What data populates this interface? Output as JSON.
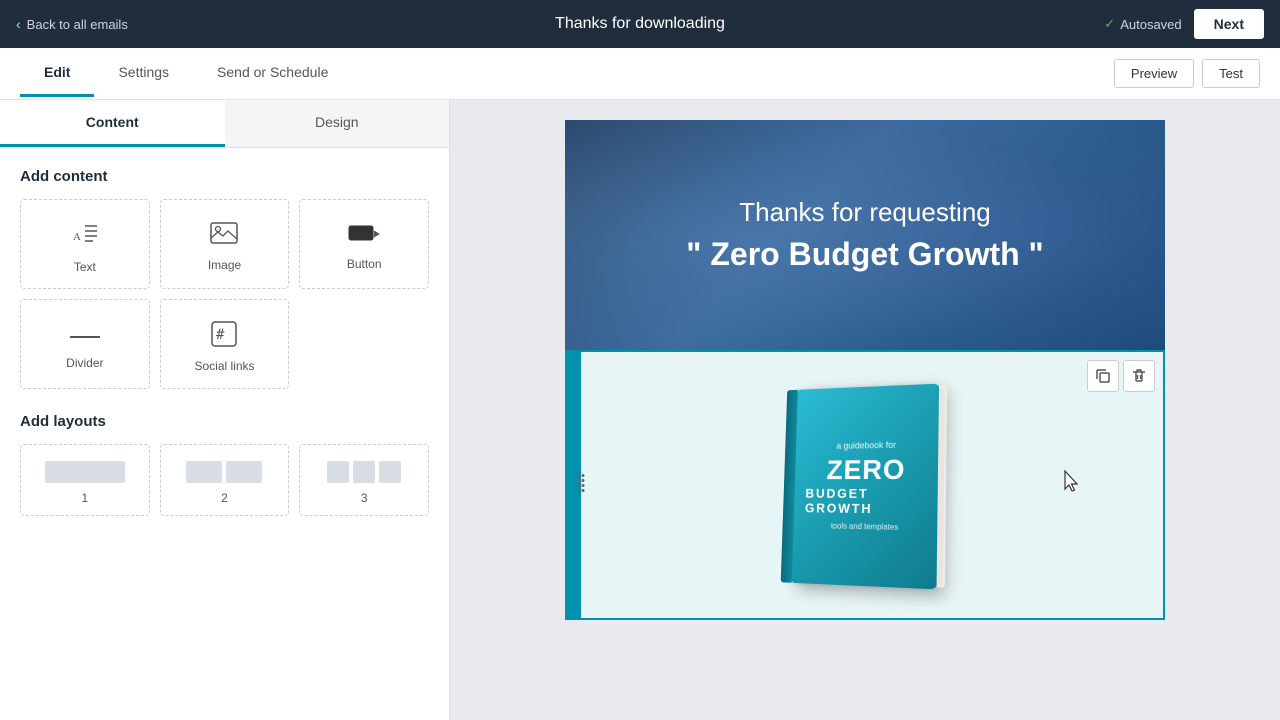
{
  "topNav": {
    "backLabel": "Back to all emails",
    "title": "Thanks for downloading",
    "autosaved": "Autosaved",
    "nextLabel": "Next"
  },
  "subNav": {
    "tabs": [
      {
        "id": "edit",
        "label": "Edit",
        "active": true
      },
      {
        "id": "settings",
        "label": "Settings",
        "active": false
      },
      {
        "id": "send-schedule",
        "label": "Send or Schedule",
        "active": false
      }
    ],
    "actions": [
      {
        "id": "preview",
        "label": "Preview"
      },
      {
        "id": "test",
        "label": "Test"
      }
    ]
  },
  "sidebar": {
    "tabs": [
      {
        "id": "content",
        "label": "Content",
        "active": true
      },
      {
        "id": "design",
        "label": "Design",
        "active": false
      }
    ],
    "addContent": {
      "title": "Add content",
      "items": [
        {
          "id": "text",
          "label": "Text",
          "icon": "¶"
        },
        {
          "id": "image",
          "label": "Image",
          "icon": "🖼"
        },
        {
          "id": "button",
          "label": "Button",
          "icon": "⬛"
        },
        {
          "id": "divider",
          "label": "Divider",
          "icon": "—"
        },
        {
          "id": "social-links",
          "label": "Social links",
          "icon": "#"
        }
      ]
    },
    "addLayouts": {
      "title": "Add layouts",
      "items": [
        {
          "id": "layout-1",
          "label": "1",
          "cols": 1
        },
        {
          "id": "layout-2",
          "label": "2",
          "cols": 2
        },
        {
          "id": "layout-3",
          "label": "3",
          "cols": 3
        }
      ]
    }
  },
  "email": {
    "headerLine1": "Thanks for requesting",
    "headerLine2": "\" Zero Budget Growth \"",
    "bookSubtitle": "a guidebook for",
    "bookTitleZero": "ZERO",
    "bookTitleBudget": "BUDGET GROWTH",
    "bookTools": "tools and templates"
  },
  "toolbar": {
    "duplicateIcon": "⧉",
    "deleteIcon": "🗑"
  }
}
